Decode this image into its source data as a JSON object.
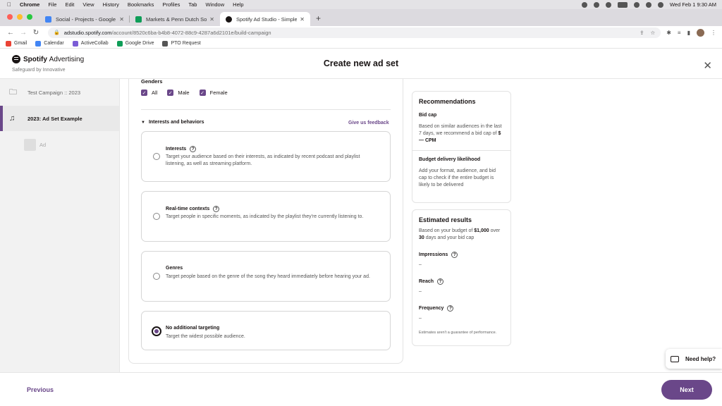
{
  "mac_menu": {
    "app": "Chrome",
    "items": [
      "File",
      "Edit",
      "View",
      "History",
      "Bookmarks",
      "Profiles",
      "Tab",
      "Window",
      "Help"
    ],
    "datetime": "Wed Feb 1  9:30 AM"
  },
  "browser": {
    "tabs": [
      {
        "title": "Social - Projects - Google Driv",
        "favicon_color": "#4285f4"
      },
      {
        "title": "Markets & Penn Dutch Social F",
        "favicon_color": "#0f9d58"
      },
      {
        "title": "Spotify Ad Studio - Simple Self",
        "favicon_color": "#191414"
      }
    ],
    "url_host": "adstudio.spotify.com",
    "url_path": "/account/8520c6ba-b4b8-4072-88c9-4287a6d2101e/build-campaign",
    "bookmarks": [
      {
        "label": "Gmail",
        "color": "#ea4335"
      },
      {
        "label": "Calendar",
        "color": "#4285f4"
      },
      {
        "label": "ActiveCollab",
        "color": "#7b5cd6"
      },
      {
        "label": "Google Drive",
        "color": "#0f9d58"
      },
      {
        "label": "PTO Request",
        "color": "#555555"
      }
    ]
  },
  "header": {
    "brand": "Spotify",
    "brand_suffix": "Advertising",
    "org": "Safeguard by Innovative",
    "title": "Create new ad set"
  },
  "sidebar": {
    "campaign": "Test Campaign :: 2023",
    "ad_set": "2023: Ad Set Example",
    "ad": "Ad"
  },
  "targeting": {
    "genders_label": "Genders",
    "genders": [
      "All",
      "Male",
      "Female"
    ],
    "section_label": "Interests and behaviors",
    "feedback_link": "Give us feedback",
    "options": [
      {
        "title": "Interests",
        "desc": "Target your audience based on their interests, as indicated by recent podcast and playlist listening, as well as streaming platform.",
        "selected": false
      },
      {
        "title": "Real-time contexts",
        "desc": "Target people in specific moments, as indicated by the playlist they're currently listening to.",
        "selected": false
      },
      {
        "title": "Genres",
        "desc": "Target people based on the genre of the song they heard immediately before hearing your ad.",
        "selected": false
      },
      {
        "title": "No additional targeting",
        "desc": "Target the widest possible audience.",
        "selected": true
      }
    ]
  },
  "recommendations": {
    "title": "Recommendations",
    "bid_cap_title": "Bid cap",
    "bid_cap_text": "Based on similar audiences in the last 7 days, we recommend a bid cap of",
    "bid_cap_value": "$— CPM",
    "budget_title": "Budget delivery likelihood",
    "budget_text": "Add your format, audience, and bid cap to check if the entire budget is likely to be delivered"
  },
  "estimates": {
    "title": "Estimated results",
    "text_a": "Based on your budget of",
    "budget": "$1,000",
    "text_b": "over",
    "days": "30",
    "text_c": "days and your bid cap",
    "stats": [
      {
        "label": "Impressions",
        "value": "–"
      },
      {
        "label": "Reach",
        "value": "–"
      },
      {
        "label": "Frequency",
        "value": "–"
      }
    ],
    "disclaimer": "Estimates aren't a guarantee of performance."
  },
  "help_label": "Need help?",
  "footer": {
    "previous": "Previous",
    "next": "Next"
  },
  "colors": {
    "accent": "#6a4789"
  }
}
